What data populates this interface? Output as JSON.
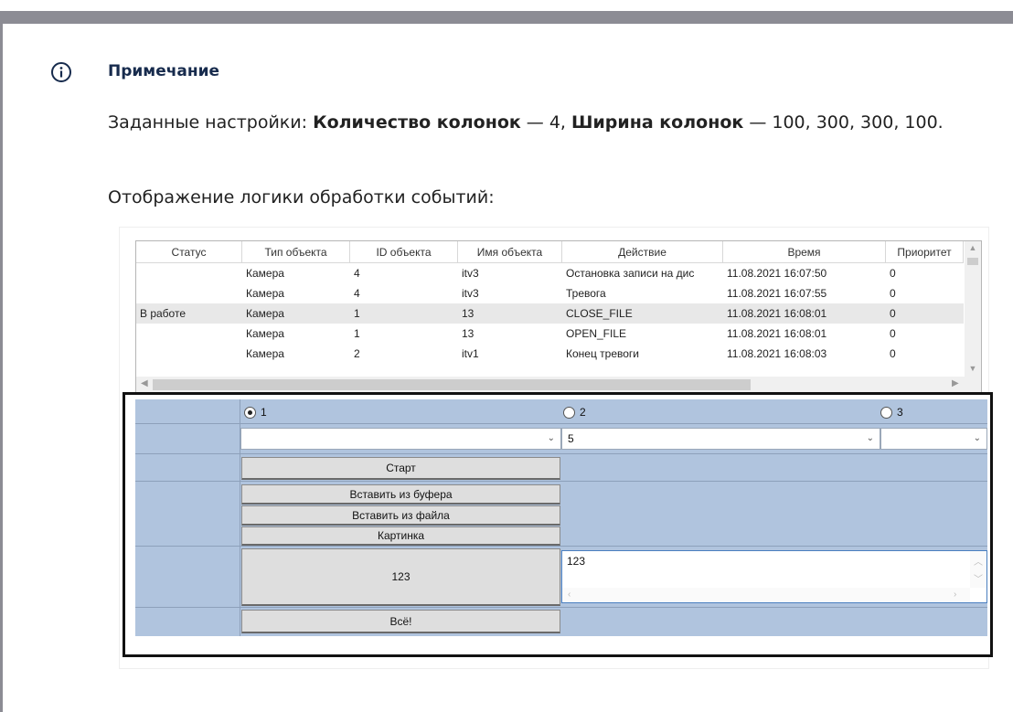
{
  "note": {
    "title": "Примечание",
    "p1_before": "Заданные настройки: ",
    "p1_bold1": "Количество колонок",
    "p1_mid": " — 4, ",
    "p1_bold2": "Ширина колонок",
    "p1_after": " — 100, 300, 300, 100.",
    "p2": "Отображение логики обработки событий:"
  },
  "grid": {
    "headers": [
      "Статус",
      "Тип объекта",
      "ID объекта",
      "Имя объекта",
      "Действие",
      "Время",
      "Приоритет"
    ],
    "rows": [
      [
        "",
        "Камера",
        "4",
        "itv3",
        "Остановка записи на дис",
        "11.08.2021 16:07:50",
        "0"
      ],
      [
        "",
        "Камера",
        "4",
        "itv3",
        "Тревога",
        "11.08.2021 16:07:55",
        "0"
      ],
      [
        "В работе",
        "Камера",
        "1",
        "13",
        "CLOSE_FILE",
        "11.08.2021 16:08:01",
        "0"
      ],
      [
        "",
        "Камера",
        "1",
        "13",
        "OPEN_FILE",
        "11.08.2021 16:08:01",
        "0"
      ],
      [
        "",
        "Камера",
        "2",
        "itv1",
        "Конец тревоги",
        "11.08.2021 16:08:03",
        "0"
      ]
    ],
    "selected_row": 2
  },
  "form": {
    "radios": [
      {
        "label": "1",
        "checked": true
      },
      {
        "label": "2",
        "checked": false
      },
      {
        "label": "3",
        "checked": false
      }
    ],
    "combo1_value": "",
    "combo2_value": "5",
    "combo3_value": "",
    "start_button": "Старт",
    "paste_buffer_button": "Вставить из буфера",
    "paste_file_button": "Вставить из файла",
    "picture_button": "Картинка",
    "value_button": "123",
    "textbox_value": "123",
    "done_button": "Всё!"
  },
  "colors": {
    "form_background": "#b0c4de",
    "title_color": "#172b4d",
    "top_bar": "#8c8c94",
    "text_border_focus": "#4a7fc0"
  },
  "icons": {
    "note_icon": "info-icon",
    "combo_chevron": "chevron-down-icon",
    "scroll_up": "chevron-up-icon",
    "scroll_down": "chevron-down-icon",
    "scroll_left": "chevron-left-icon",
    "scroll_right": "chevron-right-icon"
  }
}
